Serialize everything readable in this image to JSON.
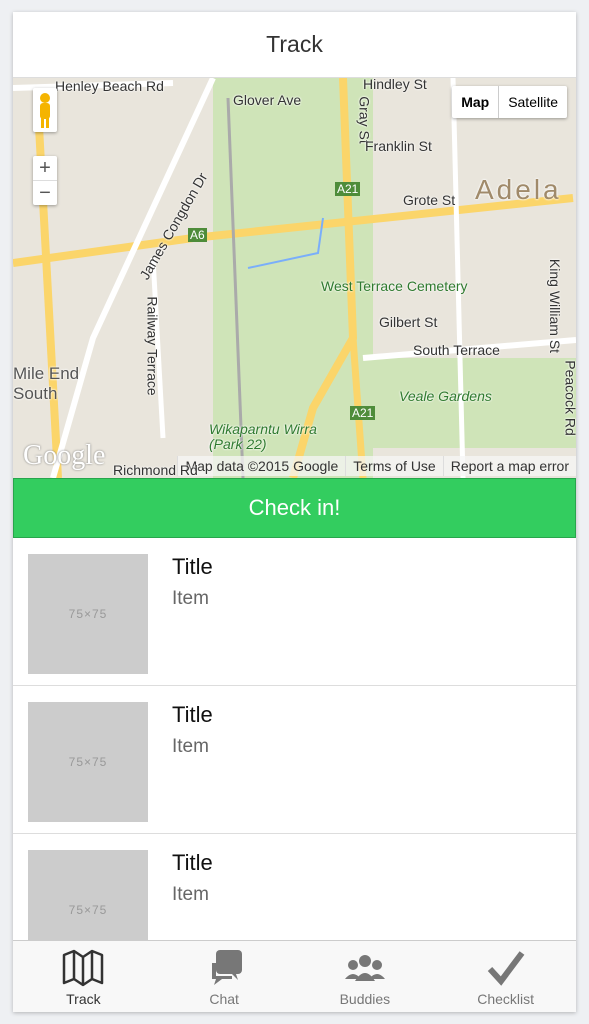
{
  "header": {
    "title": "Track"
  },
  "map": {
    "map_type_options": [
      "Map",
      "Satellite"
    ],
    "selected_map_type": "Map",
    "zoom_in": "+",
    "zoom_out": "−",
    "logo": "Google",
    "attribution": {
      "data": "Map data ©2015 Google",
      "terms": "Terms of Use",
      "report": "Report a map error"
    },
    "labels": {
      "henley": "Henley Beach Rd",
      "glover": "Glover Ave",
      "hindley": "Hindley St",
      "gray": "Gray St",
      "franklin": "Franklin St",
      "grote": "Grote St",
      "adelaide": "Adela",
      "king": "King William St",
      "james": "James Congdon Dr",
      "a6": "A6",
      "a21a": "A21",
      "a21b": "A21",
      "cemetery": "West Terrace Cemetery",
      "gilbert": "Gilbert St",
      "south": "South Terrace",
      "railway": "Railway Terrace",
      "mileend": "Mile End South",
      "veale": "Veale Gardens",
      "wika": "Wikaparntu Wirra (Park 22)",
      "richmond": "Richmond Rd",
      "peacock": "Peacock Rd"
    }
  },
  "checkin": {
    "label": "Check in!"
  },
  "list": [
    {
      "thumb": "75×75",
      "title": "Title",
      "subtitle": "Item"
    },
    {
      "thumb": "75×75",
      "title": "Title",
      "subtitle": "Item"
    },
    {
      "thumb": "75×75",
      "title": "Title",
      "subtitle": "Item"
    }
  ],
  "tabs": [
    {
      "label": "Track",
      "icon": "map-icon",
      "active": true
    },
    {
      "label": "Chat",
      "icon": "chat-icon"
    },
    {
      "label": "Buddies",
      "icon": "people-icon"
    },
    {
      "label": "Checklist",
      "icon": "checkmark-icon"
    }
  ],
  "colors": {
    "accent": "#33cd5f",
    "background": "#eef0f3"
  }
}
